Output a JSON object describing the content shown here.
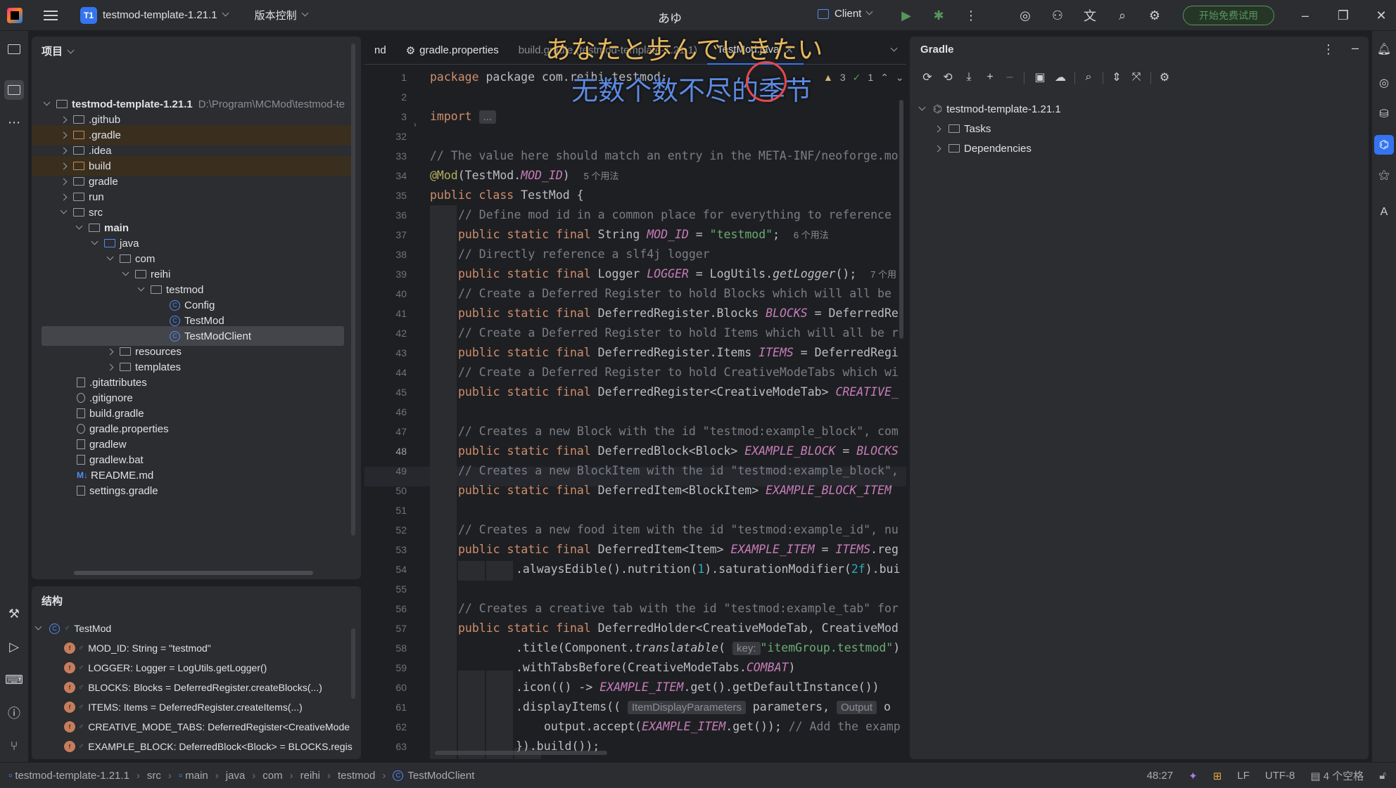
{
  "titlebar": {
    "project_badge": "T1",
    "project_name": "testmod-template-1.21.1",
    "vcs_label": "版本控制",
    "center_text": "あゆ",
    "run_config": "Client",
    "trial_button": "开始免费试用"
  },
  "project_panel": {
    "title": "项目",
    "root_name": "testmod-template-1.21.1",
    "root_path": "D:\\Program\\MCMod\\testmod-te",
    "items": [
      {
        "label": ".github"
      },
      {
        "label": ".gradle"
      },
      {
        "label": ".idea"
      },
      {
        "label": "build"
      },
      {
        "label": "gradle"
      },
      {
        "label": "run"
      },
      {
        "label": "src"
      },
      {
        "label": "main"
      },
      {
        "label": "java"
      },
      {
        "label": "com"
      },
      {
        "label": "reihi"
      },
      {
        "label": "testmod"
      },
      {
        "label": "Config"
      },
      {
        "label": "TestMod"
      },
      {
        "label": "TestModClient"
      },
      {
        "label": "resources"
      },
      {
        "label": "templates"
      },
      {
        "label": ".gitattributes"
      },
      {
        "label": ".gitignore"
      },
      {
        "label": "build.gradle"
      },
      {
        "label": "gradle.properties"
      },
      {
        "label": "gradlew"
      },
      {
        "label": "gradlew.bat"
      },
      {
        "label": "README.md"
      },
      {
        "label": "settings.gradle"
      }
    ]
  },
  "structure_panel": {
    "title": "结构",
    "root": "TestMod",
    "fields": [
      "MOD_ID: String = \"testmod\"",
      "LOGGER: Logger = LogUtils.getLogger()",
      "BLOCKS: Blocks = DeferredRegister.createBlocks(...)",
      "ITEMS: Items = DeferredRegister.createItems(...)",
      "CREATIVE_MODE_TABS: DeferredRegister<CreativeMode",
      "EXAMPLE_BLOCK: DeferredBlock<Block> = BLOCKS.regis"
    ]
  },
  "editor": {
    "tabs": [
      "nd",
      "gradle.properties",
      "build.gradle (testmod-template-1.21.1)",
      "TestMod.java"
    ],
    "warnings": "3",
    "checks": "1",
    "lyrics": [
      "あなたと歩んでいきたい",
      "无数个数不尽的季节"
    ],
    "line_numbers": [
      "1",
      "2",
      "3",
      "32",
      "33",
      "34",
      "35",
      "36",
      "37",
      "38",
      "39",
      "40",
      "41",
      "42",
      "43",
      "44",
      "45",
      "46",
      "47",
      "48",
      "49",
      "50",
      "51",
      "52",
      "53",
      "54",
      "55",
      "56",
      "57",
      "58",
      "59",
      "60",
      "61",
      "62",
      "63"
    ],
    "current_line": "48",
    "hints": {
      "usages_5": "5 个用法",
      "usages_6": "6 个用法",
      "usages_7": "7 个用",
      "key": "key:",
      "item_display_params": "ItemDisplayParameters",
      "output": "Output"
    },
    "code": {
      "l1": "package com.reihi.testmod;",
      "l3_kw": "import",
      "l3_fold": "...",
      "l33": "// The value here should match an entry in the META-INF/neoforge.mo",
      "l34_ann": "@Mod",
      "l34_rest": "(TestMod.",
      "l34_it": "MOD_ID",
      "l34_close": ")",
      "l35_kw": "public class",
      "l35_rest": " TestMod {",
      "l36": "// Define mod id in a common place for everything to reference",
      "l37_kw": "public static final",
      "l37_type": " String ",
      "l37_it": "MOD_ID",
      "l37_eq": " = ",
      "l37_str": "\"testmod\"",
      "l37_semi": ";",
      "l38": "// Directly reference a slf4j logger",
      "l39_kw": "public static final",
      "l39_type": " Logger ",
      "l39_it": "LOGGER",
      "l39_eq": " = LogUtils.",
      "l39_fn": "getLogger",
      "l39_end": "();",
      "l40": "// Create a Deferred Register to hold Blocks which will all be",
      "l41_kw": "public static final",
      "l41_type": " DeferredRegister.Blocks ",
      "l41_it": "BLOCKS",
      "l41_end": " = DeferredRe",
      "l42": "// Create a Deferred Register to hold Items which will all be r",
      "l43_kw": "public static final",
      "l43_type": " DeferredRegister.Items ",
      "l43_it": "ITEMS",
      "l43_end": " = DeferredRegi",
      "l44": "// Create a Deferred Register to hold CreativeModeTabs which wi",
      "l45_kw": "public static final",
      "l45_type": " DeferredRegister<CreativeModeTab> ",
      "l45_it": "CREATIVE_",
      "l47": "// Creates a new Block with the id \"testmod:example_block\", com",
      "l48_kw": "public static final",
      "l48_type": " DeferredBlock<Block> ",
      "l48_it": "EXAMPLE_BLOCK",
      "l48_eq": " = ",
      "l48_it2": "BLOCKS",
      "l49": "// Creates a new BlockItem with the id \"testmod:example_block\",",
      "l50_kw": "public static final",
      "l50_type": " DeferredItem<BlockItem> ",
      "l50_it": "EXAMPLE_BLOCK_ITEM",
      "l52": "// Creates a new food item with the id \"testmod:example_id\", nu",
      "l53_kw": "public static final",
      "l53_type": " DeferredItem<Item> ",
      "l53_it": "EXAMPLE_ITEM",
      "l53_eq": " = ",
      "l53_it2": "ITEMS",
      "l53_end": ".reg",
      "l54_a": ".alwaysEdible().nutrition(",
      "l54_n1": "1",
      "l54_b": ").saturationModifier(",
      "l54_n2": "2f",
      "l54_c": ").bui",
      "l56": "// Creates a creative tab with the id \"testmod:example_tab\" for",
      "l57_kw": "public static final",
      "l57_type": " DeferredHolder<CreativeModeTab, CreativeMod",
      "l58_a": ".title(Component.",
      "l58_it": "translatable",
      "l58_b": "( ",
      "l58_str": "\"itemGroup.testmod\"",
      "l58_c": ")",
      "l59_a": ".withTabsBefore(CreativeModeTabs.",
      "l59_it": "COMBAT",
      "l59_b": ")",
      "l60_a": ".icon(() -> ",
      "l60_it": "EXAMPLE_ITEM",
      "l60_b": ".get().getDefaultInstance())",
      "l61_a": ".displayItems(( ",
      "l61_b": " parameters, ",
      "l61_c": " o",
      "l62_a": "output.accept(",
      "l62_it": "EXAMPLE_ITEM",
      "l62_b": ".get()); ",
      "l62_cm": "// Add the examp",
      "l63": "}).build());"
    }
  },
  "gradle_panel": {
    "title": "Gradle",
    "root": "testmod-template-1.21.1",
    "children": [
      "Tasks",
      "Dependencies"
    ]
  },
  "statusbar": {
    "breadcrumbs": [
      "testmod-template-1.21.1",
      "src",
      "main",
      "java",
      "com",
      "reihi",
      "testmod",
      "TestModClient"
    ],
    "position": "48:27",
    "line_sep": "LF",
    "encoding": "UTF-8",
    "indent": "4 个空格"
  }
}
